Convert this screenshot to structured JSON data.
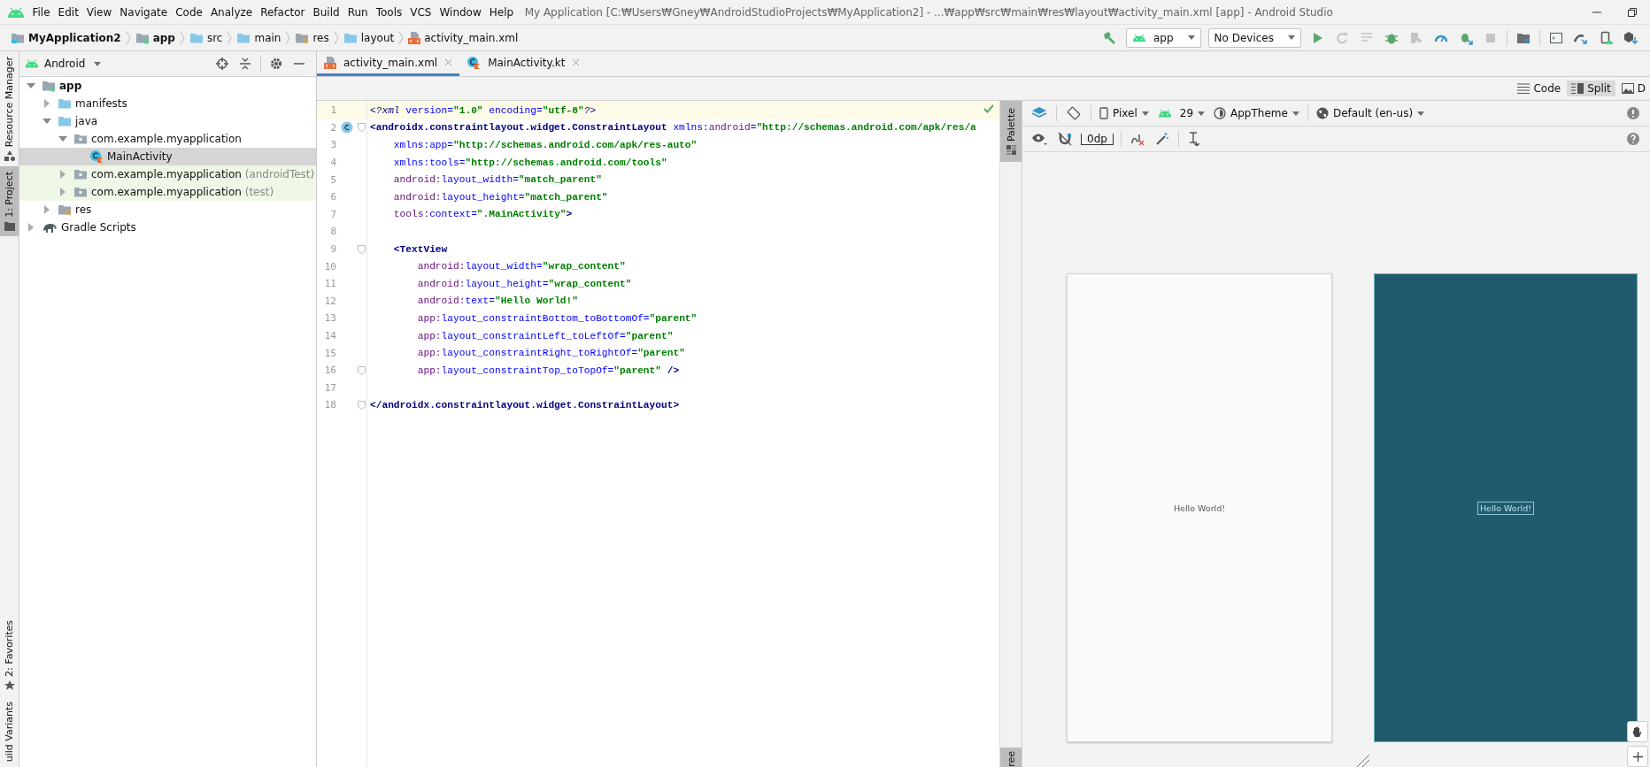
{
  "menu": [
    "File",
    "Edit",
    "View",
    "Navigate",
    "Code",
    "Analyze",
    "Refactor",
    "Build",
    "Run",
    "Tools",
    "VCS",
    "Window",
    "Help"
  ],
  "window": {
    "title": "My Application [C:₩Users₩Gney₩AndroidStudioProjects₩MyApplication2] - ...₩app₩src₩main₩res₩layout₩activity_main.xml [app] - Android Studio"
  },
  "breadcrumbs": [
    {
      "label": "MyApplication2",
      "kind": "project"
    },
    {
      "label": "app",
      "kind": "module"
    },
    {
      "label": "src",
      "kind": "folder"
    },
    {
      "label": "main",
      "kind": "folder"
    },
    {
      "label": "res",
      "kind": "res"
    },
    {
      "label": "layout",
      "kind": "folder"
    },
    {
      "label": "activity_main.xml",
      "kind": "xml"
    }
  ],
  "run_config": {
    "module": "app",
    "device": "No Devices"
  },
  "left_stripe": {
    "top": [
      {
        "label": "Resource Manager",
        "selected": false
      },
      {
        "label": "1: Project",
        "selected": true
      }
    ],
    "bottom": [
      {
        "label": "2: Favorites",
        "selected": false
      },
      {
        "label": "uild Variants",
        "selected": false
      }
    ]
  },
  "project": {
    "view": "Android",
    "tree": [
      {
        "label": "app",
        "kind": "module",
        "expanded": true,
        "selected": false,
        "children": [
          {
            "label": "manifests",
            "kind": "folder",
            "expanded": false,
            "selected": false
          },
          {
            "label": "java",
            "kind": "folder",
            "expanded": true,
            "selected": false,
            "children": [
              {
                "label": "com.example.myapplication",
                "kind": "package",
                "expanded": true,
                "selected": false,
                "children": [
                  {
                    "label": "MainActivity",
                    "kind": "class",
                    "selected": true
                  }
                ]
              },
              {
                "label": "com.example.myapplication",
                "suffix": "(androidTest)",
                "kind": "test-package",
                "expanded": false,
                "selected": false
              },
              {
                "label": "com.example.myapplication",
                "suffix": "(test)",
                "kind": "test-package",
                "expanded": false,
                "selected": false
              }
            ]
          },
          {
            "label": "res",
            "kind": "res",
            "expanded": false,
            "selected": false
          }
        ]
      },
      {
        "label": "Gradle Scripts",
        "kind": "gradle",
        "expanded": false,
        "selected": false
      }
    ]
  },
  "tabs": [
    {
      "label": "activity_main.xml",
      "kind": "xml",
      "selected": true
    },
    {
      "label": "MainActivity.kt",
      "kind": "kotlin",
      "selected": false
    }
  ],
  "view_modes": [
    {
      "label": "Code",
      "kind": "code",
      "selected": false
    },
    {
      "label": "Split",
      "kind": "split",
      "selected": true
    },
    {
      "label": "D",
      "kind": "design",
      "selected": false
    }
  ],
  "editor": {
    "lines": [
      {
        "number": "1",
        "current": true,
        "marker": false,
        "fold": false,
        "segments": [
          {
            "kind": "prolog",
            "text": "<?xml "
          },
          {
            "kind": "attr",
            "text": "version="
          },
          {
            "kind": "value",
            "text": "\"1.0\""
          },
          {
            "kind": "attr",
            "text": " encoding="
          },
          {
            "kind": "value",
            "text": "\"utf-8\""
          },
          {
            "kind": "prolog",
            "text": "?>"
          }
        ]
      },
      {
        "number": "2",
        "current": false,
        "marker": true,
        "fold": true,
        "segments": [
          {
            "kind": "tag",
            "text": "<androidx.constraintlayout.widget.ConstraintLayout"
          },
          {
            "kind": "attr",
            "text": " xmlns:"
          },
          {
            "kind": "ns",
            "text": "android"
          },
          {
            "kind": "attr",
            "text": "="
          },
          {
            "kind": "value",
            "text": "\"http://schemas.android.com/apk/res/a"
          }
        ]
      },
      {
        "number": "3",
        "current": false,
        "marker": false,
        "fold": false,
        "segments": [
          {
            "kind": "attr",
            "text": "    xmlns:app="
          },
          {
            "kind": "value",
            "text": "\"http://schemas.android.com/apk/res-auto\""
          }
        ]
      },
      {
        "number": "4",
        "current": false,
        "marker": false,
        "fold": false,
        "segments": [
          {
            "kind": "attr",
            "text": "    xmlns:tools="
          },
          {
            "kind": "value",
            "text": "\"http://schemas.android.com/tools\""
          }
        ]
      },
      {
        "number": "5",
        "current": false,
        "marker": false,
        "fold": false,
        "segments": [
          {
            "kind": "ns",
            "text": "    android:"
          },
          {
            "kind": "attr",
            "text": "layout_width="
          },
          {
            "kind": "value",
            "text": "\"match_parent\""
          }
        ]
      },
      {
        "number": "6",
        "current": false,
        "marker": false,
        "fold": false,
        "segments": [
          {
            "kind": "ns",
            "text": "    android:"
          },
          {
            "kind": "attr",
            "text": "layout_height="
          },
          {
            "kind": "value",
            "text": "\"match_parent\""
          }
        ]
      },
      {
        "number": "7",
        "current": false,
        "marker": false,
        "fold": false,
        "segments": [
          {
            "kind": "ns",
            "text": "    tools:"
          },
          {
            "kind": "attr",
            "text": "context="
          },
          {
            "kind": "value",
            "text": "\".MainActivity\""
          },
          {
            "kind": "tag",
            "text": ">"
          }
        ]
      },
      {
        "number": "8",
        "current": false,
        "marker": false,
        "fold": false
      },
      {
        "number": "9",
        "current": false,
        "marker": false,
        "fold": true,
        "segments": [
          {
            "kind": "tag",
            "text": "    <TextView"
          }
        ]
      },
      {
        "number": "10",
        "current": false,
        "marker": false,
        "fold": false,
        "segments": [
          {
            "kind": "ns",
            "text": "        android:"
          },
          {
            "kind": "attr",
            "text": "layout_width="
          },
          {
            "kind": "value",
            "text": "\"wrap_content\""
          }
        ]
      },
      {
        "number": "11",
        "current": false,
        "marker": false,
        "fold": false,
        "segments": [
          {
            "kind": "ns",
            "text": "        android:"
          },
          {
            "kind": "attr",
            "text": "layout_height="
          },
          {
            "kind": "value",
            "text": "\"wrap_content\""
          }
        ]
      },
      {
        "number": "12",
        "current": false,
        "marker": false,
        "fold": false,
        "segments": [
          {
            "kind": "ns",
            "text": "        android:"
          },
          {
            "kind": "attr",
            "text": "text="
          },
          {
            "kind": "value",
            "text": "\"Hello World!\""
          }
        ]
      },
      {
        "number": "13",
        "current": false,
        "marker": false,
        "fold": false,
        "segments": [
          {
            "kind": "ns",
            "text": "        app:"
          },
          {
            "kind": "attr",
            "text": "layout_constraintBottom_toBottomOf="
          },
          {
            "kind": "value",
            "text": "\"parent\""
          }
        ]
      },
      {
        "number": "14",
        "current": false,
        "marker": false,
        "fold": false,
        "segments": [
          {
            "kind": "ns",
            "text": "        app:"
          },
          {
            "kind": "attr",
            "text": "layout_constraintLeft_toLeftOf="
          },
          {
            "kind": "value",
            "text": "\"parent\""
          }
        ]
      },
      {
        "number": "15",
        "current": false,
        "marker": false,
        "fold": false,
        "segments": [
          {
            "kind": "ns",
            "text": "        app:"
          },
          {
            "kind": "attr",
            "text": "layout_constraintRight_toRightOf="
          },
          {
            "kind": "value",
            "text": "\"parent\""
          }
        ]
      },
      {
        "number": "16",
        "current": false,
        "marker": false,
        "fold": true,
        "segments": [
          {
            "kind": "ns",
            "text": "        app:"
          },
          {
            "kind": "attr",
            "text": "layout_constraintTop_toTopOf="
          },
          {
            "kind": "value",
            "text": "\"parent\""
          },
          {
            "kind": "tag",
            "text": " />"
          }
        ]
      },
      {
        "number": "17",
        "current": false,
        "marker": false,
        "fold": false
      },
      {
        "number": "18",
        "current": false,
        "marker": false,
        "fold": true,
        "segments": [
          {
            "kind": "tag",
            "text": "</androidx.constraintlayout.widget.ConstraintLayout>"
          }
        ]
      }
    ]
  },
  "palette_stripe": {
    "top": "Palette",
    "bottom": "ree"
  },
  "designer": {
    "device": "Pixel",
    "api": "29",
    "theme": "AppTheme",
    "locale": "Default (en-us)",
    "margin": "0dp",
    "previews": [
      {
        "kind": "design",
        "text": "Hello World!"
      },
      {
        "kind": "blueprint",
        "text": "Hello World!"
      }
    ]
  }
}
